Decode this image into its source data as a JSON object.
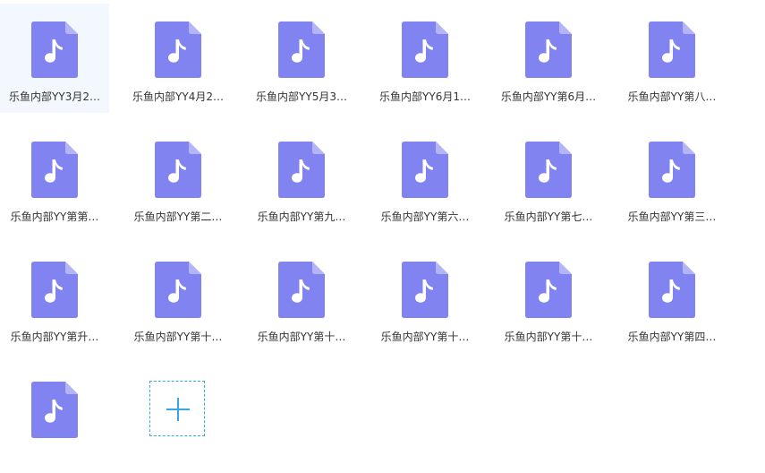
{
  "accent_color": "#38a7e8",
  "icon_color": "#8083f0",
  "files": [
    {
      "name": "乐鱼内部YY3月2…",
      "icon": "music-file-icon",
      "selected": true
    },
    {
      "name": "乐鱼内部YY4月2…",
      "icon": "music-file-icon"
    },
    {
      "name": "乐鱼内部YY5月3…",
      "icon": "music-file-icon"
    },
    {
      "name": "乐鱼内部YY6月1…",
      "icon": "music-file-icon"
    },
    {
      "name": "乐鱼内部YY第6月…",
      "icon": "music-file-icon"
    },
    {
      "name": "乐鱼内部YY第八…",
      "icon": "music-file-icon"
    },
    {
      "name": "乐鱼内部YY第第…",
      "icon": "music-file-icon"
    },
    {
      "name": "乐鱼内部YY第二…",
      "icon": "music-file-icon"
    },
    {
      "name": "乐鱼内部YY第九…",
      "icon": "music-file-icon"
    },
    {
      "name": "乐鱼内部YY第六…",
      "icon": "music-file-icon"
    },
    {
      "name": "乐鱼内部YY第七…",
      "icon": "music-file-icon"
    },
    {
      "name": "乐鱼内部YY第三…",
      "icon": "music-file-icon"
    },
    {
      "name": "乐鱼内部YY第升…",
      "icon": "music-file-icon"
    },
    {
      "name": "乐鱼内部YY第十…",
      "icon": "music-file-icon"
    },
    {
      "name": "乐鱼内部YY第十…",
      "icon": "music-file-icon"
    },
    {
      "name": "乐鱼内部YY第十…",
      "icon": "music-file-icon"
    },
    {
      "name": "乐鱼内部YY第十…",
      "icon": "music-file-icon"
    },
    {
      "name": "乐鱼内部YY第四…",
      "icon": "music-file-icon"
    },
    {
      "name": "",
      "icon": "music-file-icon"
    }
  ],
  "add_tile": {
    "icon": "plus-icon"
  }
}
